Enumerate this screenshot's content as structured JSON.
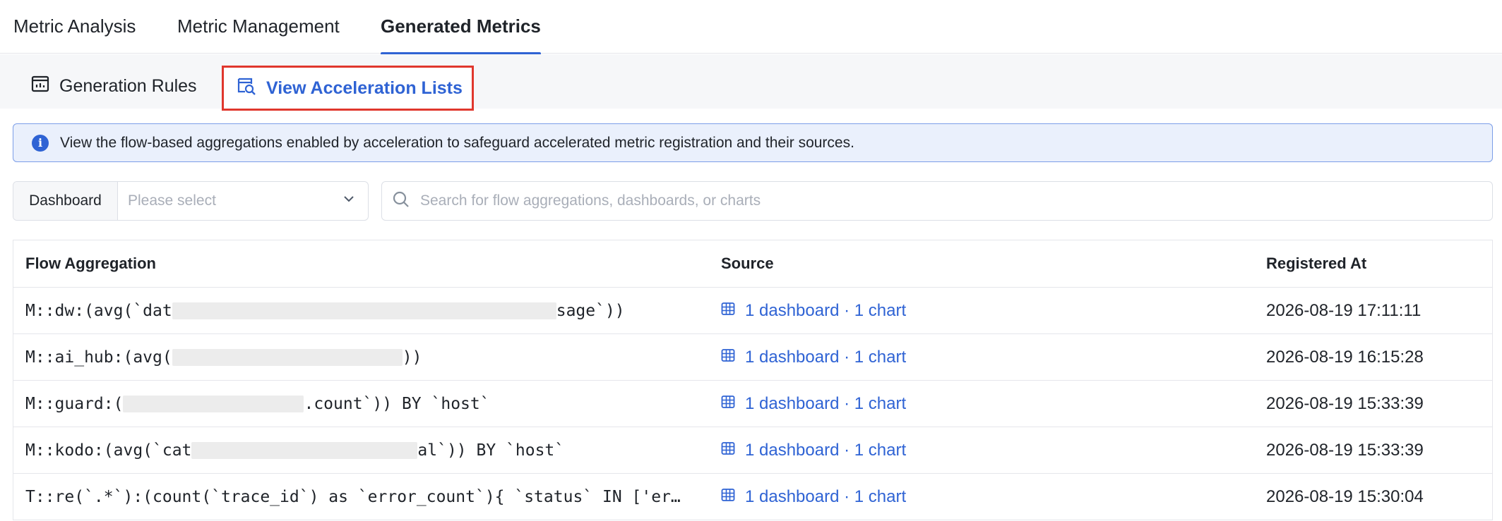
{
  "top_tabs": [
    {
      "label": "Metric Analysis",
      "active": false
    },
    {
      "label": "Metric Management",
      "active": false
    },
    {
      "label": "Generated Metrics",
      "active": true
    }
  ],
  "sub_nav": {
    "generation_rules": "Generation Rules",
    "view_acceleration_lists": "View Acceleration Lists"
  },
  "banner": {
    "icon": "info-icon",
    "text": "View the flow-based aggregations enabled by acceleration to safeguard accelerated metric registration and their sources."
  },
  "filters": {
    "dashboard_label": "Dashboard",
    "dashboard_placeholder": "Please select",
    "search_placeholder": "Search for flow aggregations, dashboards, or charts"
  },
  "table": {
    "headers": {
      "flow_aggregation": "Flow Aggregation",
      "source": "Source",
      "registered_at": "Registered At"
    },
    "rows": [
      {
        "agg_prefix": "M::dw:(avg(`dat",
        "agg_suffix": "sage`))",
        "source": "1 dashboard · 1 chart",
        "registered_at": "2026-08-19 17:11:11"
      },
      {
        "agg_prefix": "M::ai_hub:(avg(",
        "agg_suffix": "))",
        "source": "1 dashboard · 1 chart",
        "registered_at": "2026-08-19 16:15:28"
      },
      {
        "agg_prefix": "M::guard:(",
        "agg_suffix": ".count`)) BY `host`",
        "source": "1 dashboard · 1 chart",
        "registered_at": "2026-08-19 15:33:39"
      },
      {
        "agg_prefix": "M::kodo:(avg(`cat",
        "agg_suffix": "al`)) BY `host`",
        "source": "1 dashboard · 1 chart",
        "registered_at": "2026-08-19 15:33:39"
      },
      {
        "agg_prefix": "T::re(`.*`):(count(`trace_id`) as `error_count`){ `status` IN ['er…",
        "agg_suffix": "",
        "source": "1 dashboard · 1 chart",
        "registered_at": "2026-08-19 15:30:04"
      }
    ]
  },
  "colors": {
    "accent": "#2f63d4",
    "highlight_border": "#e0372d",
    "banner_bg": "#eaf0fc"
  }
}
